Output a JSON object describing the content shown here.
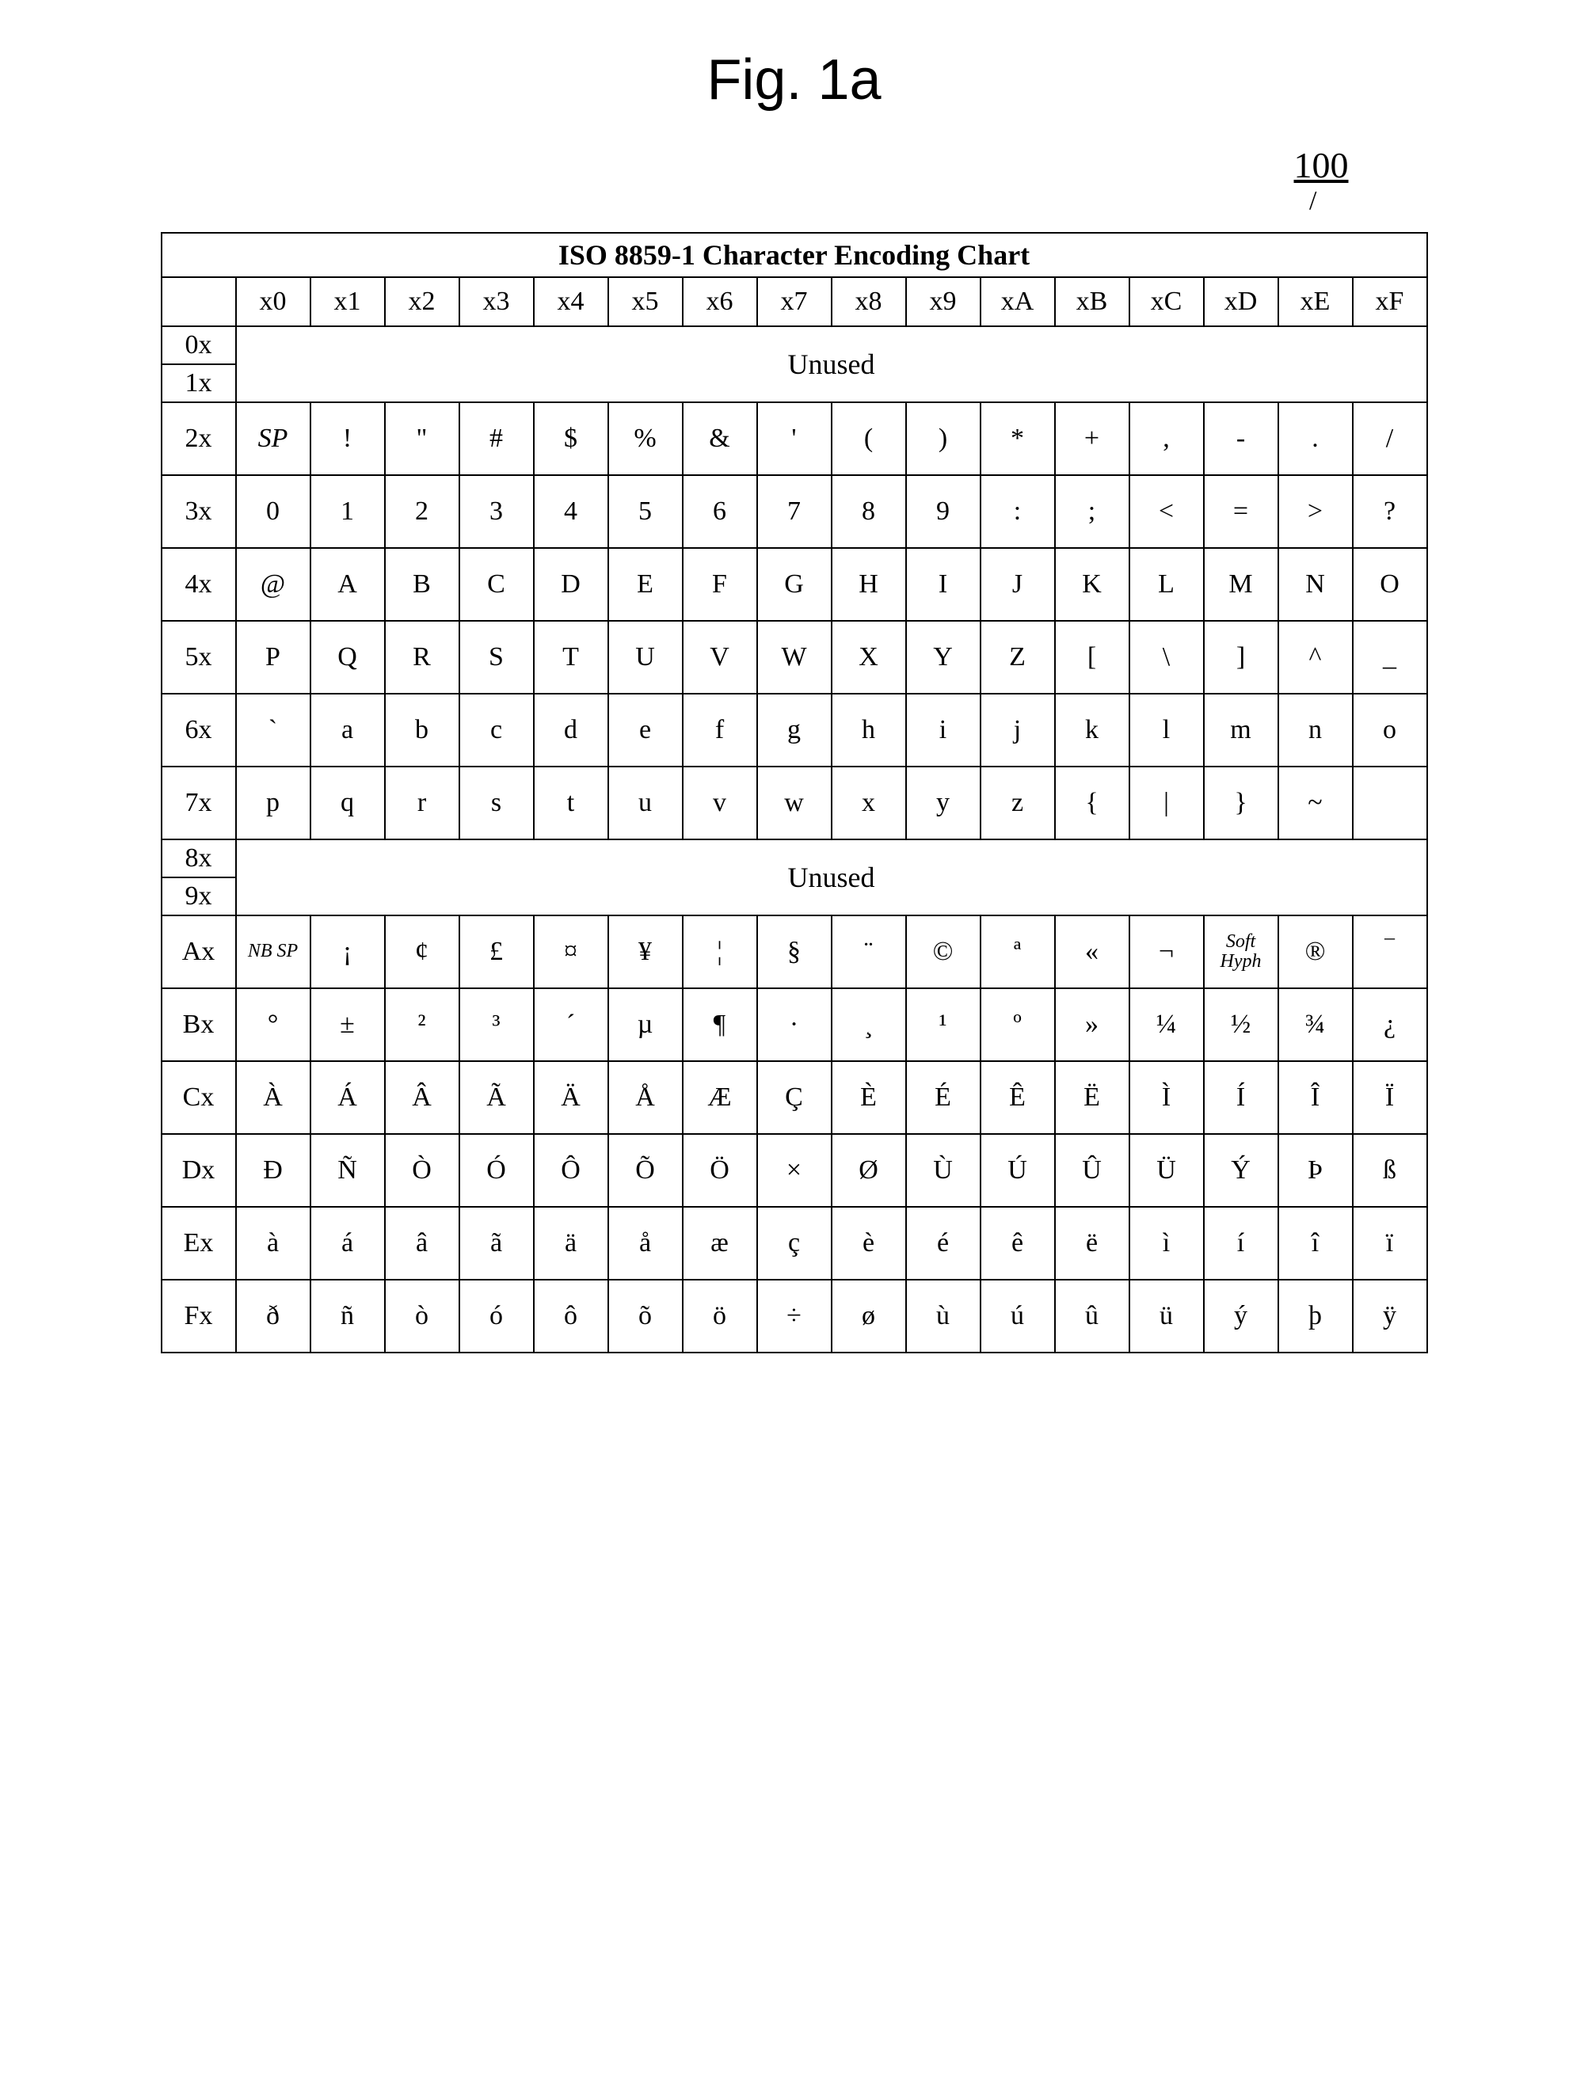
{
  "figure": {
    "label": "Fig. 1a",
    "ref": "100",
    "slash": "/"
  },
  "chart": {
    "title": "ISO 8859-1 Character Encoding Chart",
    "cols": [
      "x0",
      "x1",
      "x2",
      "x3",
      "x4",
      "x5",
      "x6",
      "x7",
      "x8",
      "x9",
      "xA",
      "xB",
      "xC",
      "xD",
      "xE",
      "xF"
    ],
    "rows": {
      "r0": "0x",
      "r1": "1x",
      "r2": "2x",
      "r3": "3x",
      "r4": "4x",
      "r5": "5x",
      "r6": "6x",
      "r7": "7x",
      "r8": "8x",
      "r9": "9x",
      "rA": "Ax",
      "rB": "Bx",
      "rC": "Cx",
      "rD": "Dx",
      "rE": "Ex",
      "rF": "Fx"
    },
    "unused": "Unused",
    "data": {
      "r2": [
        "SP",
        "!",
        "\"",
        "#",
        "$",
        "%",
        "&",
        "'",
        "(",
        ")",
        "*",
        "+",
        ",",
        "-",
        ".",
        "/"
      ],
      "r3": [
        "0",
        "1",
        "2",
        "3",
        "4",
        "5",
        "6",
        "7",
        "8",
        "9",
        ":",
        ";",
        "<",
        "=",
        ">",
        "?"
      ],
      "r4": [
        "@",
        "A",
        "B",
        "C",
        "D",
        "E",
        "F",
        "G",
        "H",
        "I",
        "J",
        "K",
        "L",
        "M",
        "N",
        "O"
      ],
      "r5": [
        "P",
        "Q",
        "R",
        "S",
        "T",
        "U",
        "V",
        "W",
        "X",
        "Y",
        "Z",
        "[",
        "\\",
        "]",
        "^",
        "_"
      ],
      "r6": [
        "`",
        "a",
        "b",
        "c",
        "d",
        "e",
        "f",
        "g",
        "h",
        "i",
        "j",
        "k",
        "l",
        "m",
        "n",
        "o"
      ],
      "r7": [
        "p",
        "q",
        "r",
        "s",
        "t",
        "u",
        "v",
        "w",
        "x",
        "y",
        "z",
        "{",
        "|",
        "}",
        "~",
        ""
      ],
      "rA": [
        "NB SP",
        "¡",
        "¢",
        "£",
        "¤",
        "¥",
        "¦",
        "§",
        "¨",
        "©",
        "ª",
        "«",
        "¬",
        "Soft Hyph",
        "®",
        "‾"
      ],
      "rB": [
        "°",
        "±",
        "²",
        "³",
        "´",
        "µ",
        "¶",
        "·",
        "¸",
        "¹",
        "º",
        "»",
        "¼",
        "½",
        "¾",
        "¿"
      ],
      "rC": [
        "À",
        "Á",
        "Â",
        "Ã",
        "Ä",
        "Å",
        "Æ",
        "Ç",
        "È",
        "É",
        "Ê",
        "Ë",
        "Ì",
        "Í",
        "Î",
        "Ï"
      ],
      "rD": [
        "Ð",
        "Ñ",
        "Ò",
        "Ó",
        "Ô",
        "Õ",
        "Ö",
        "×",
        "Ø",
        "Ù",
        "Ú",
        "Û",
        "Ü",
        "Ý",
        "Þ",
        "ß"
      ],
      "rE": [
        "à",
        "á",
        "â",
        "ã",
        "ä",
        "å",
        "æ",
        "ç",
        "è",
        "é",
        "ê",
        "ë",
        "ì",
        "í",
        "î",
        "ï"
      ],
      "rF": [
        "ð",
        "ñ",
        "ò",
        "ó",
        "ô",
        "õ",
        "ö",
        "÷",
        "ø",
        "ù",
        "ú",
        "û",
        "ü",
        "ý",
        "þ",
        "ÿ"
      ]
    }
  }
}
